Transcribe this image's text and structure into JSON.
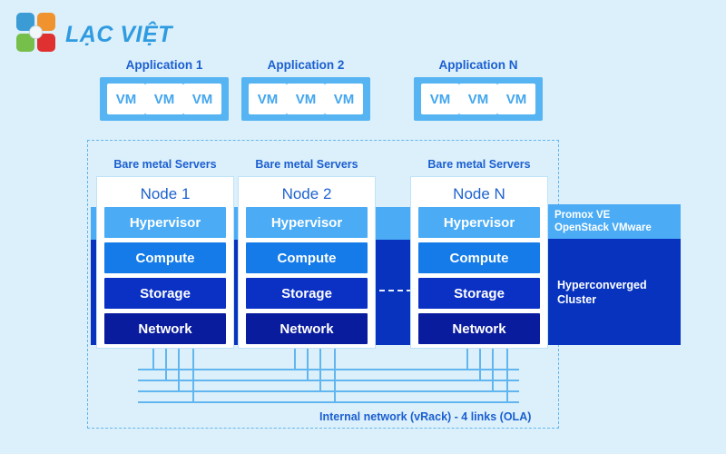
{
  "brand": {
    "name": "LẠC VIỆT",
    "logo_colors": {
      "top_left": "#3b9bd4",
      "top_right": "#f0922e",
      "bottom_left": "#76bf4a",
      "bottom_right": "#e03131",
      "text": "#2f9be0"
    }
  },
  "palette": {
    "page_background": "#dcf0fb",
    "app_container": "#56b4f2",
    "hypervisor": "#4bacf5",
    "compute": "#147be8",
    "storage": "#0a30c4",
    "network": "#0a1c9e",
    "cluster_band": "#0733be",
    "wire": "#62b6ef",
    "heading_text": "#1b5fd0"
  },
  "applications": [
    {
      "title": "Application 1",
      "vms": [
        "VM",
        "VM",
        "VM"
      ]
    },
    {
      "title": "Application 2",
      "vms": [
        "VM",
        "VM",
        "VM"
      ]
    },
    {
      "title": "Application N",
      "vms": [
        "VM",
        "VM",
        "VM"
      ]
    }
  ],
  "nodes": [
    {
      "group_label": "Bare metal Servers",
      "name": "Node 1",
      "layers": [
        "Hypervisor",
        "Compute",
        "Storage",
        "Network"
      ]
    },
    {
      "group_label": "Bare metal Servers",
      "name": "Node 2",
      "layers": [
        "Hypervisor",
        "Compute",
        "Storage",
        "Network"
      ]
    },
    {
      "group_label": "Bare metal Servers",
      "name": "Node N",
      "layers": [
        "Hypervisor",
        "Compute",
        "Storage",
        "Network"
      ]
    }
  ],
  "hyperconverged": {
    "platforms_line_1": "Promox VE",
    "platforms_line_2": "OpenStack VMware",
    "cluster_line_1": "Hyperconverged",
    "cluster_line_2": "Cluster"
  },
  "network": {
    "label": "Internal network (vRack) - 4 links (OLA)",
    "link_count": 4
  }
}
